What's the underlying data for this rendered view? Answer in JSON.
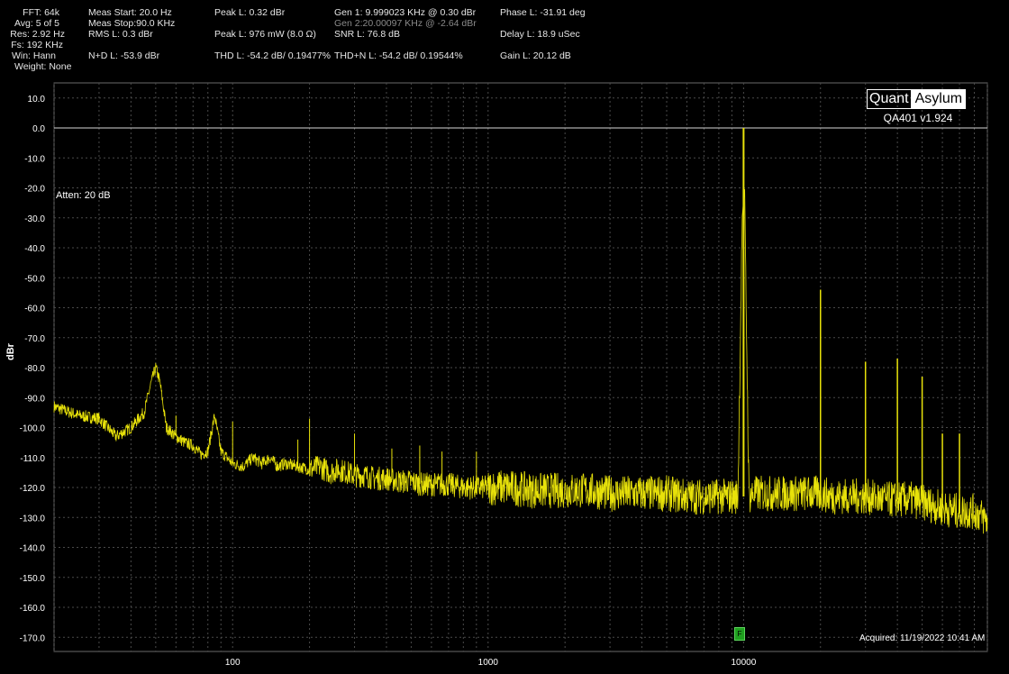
{
  "header": {
    "fft": "FFT: 64k",
    "avg": "Avg: 5 of 5",
    "res": "Res: 2.92 Hz",
    "fs": "Fs: 192 KHz",
    "win": "Win: Hann",
    "weight": "Weight: None",
    "meas_start": "Meas Start: 20.0 Hz",
    "meas_stop": "Meas Stop:90.0 KHz",
    "rms": "RMS L: 0.3 dBr",
    "nd": "N+D L: -53.9 dBr",
    "peak_l": "Peak L: 0.32 dBr",
    "peak_l_mw": "Peak L: 976 mW (8.0 Ω)",
    "thd": "THD L: -54.2 dB/ 0.19477%",
    "gen1": "Gen 1: 9.999023 KHz @ 0.30  dBr",
    "gen2": "Gen 2:20.00097 KHz @ -2.64  dBr",
    "snr": "SNR L: 76.8 dB",
    "thdn": "THD+N L: -54.2 dB/ 0.19544%",
    "phase": "Phase L: -31.91 deg",
    "delay": "Delay L: 18.9 uSec",
    "gain": "Gain L: 20.12 dB"
  },
  "logo": {
    "quant": "Quant",
    "asylum": "Asylum"
  },
  "version": "QA401 v1.924",
  "atten": "Atten: 20 dB",
  "acquired": "Acquired: 11/19/2022  10:41 AM",
  "marker_label": "F",
  "colors": {
    "trace": "#e8e20a",
    "grid": "#4a4a4a",
    "ref_line": "#d8d8d8",
    "background": "#000000"
  },
  "chart_data": {
    "type": "line",
    "title": "",
    "xlabel": "",
    "ylabel": "dBr",
    "x_scale": "log",
    "xlim": [
      20,
      90000
    ],
    "ylim": [
      -175,
      15
    ],
    "xticks": [
      100,
      1000,
      10000
    ],
    "xtick_labels": [
      "100",
      "1000",
      "10000"
    ],
    "yticks": [
      10,
      0,
      -10,
      -20,
      -30,
      -40,
      -50,
      -60,
      -70,
      -80,
      -90,
      -100,
      -110,
      -120,
      -130,
      -140,
      -150,
      -160,
      -170
    ],
    "ytick_labels": [
      "10.0",
      "0.0",
      "-10.0",
      "-20.0",
      "-30.0",
      "-40.0",
      "-50.0",
      "-60.0",
      "-70.0",
      "-80.0",
      "-90.0",
      "-100.0",
      "-110.0",
      "-120.0",
      "-130.0",
      "-140.0",
      "-150.0",
      "-160.0",
      "-170.0"
    ],
    "grid": true,
    "reference_line_y": 0,
    "series": [
      {
        "color": "#e8e20a",
        "x": [
          20,
          25,
          30,
          35,
          40,
          45,
          48,
          50,
          52,
          55,
          60,
          65,
          70,
          75,
          80,
          85,
          90,
          95,
          100,
          110,
          120,
          130,
          140,
          150,
          160,
          180,
          200,
          220,
          240,
          260,
          280,
          300,
          330,
          360,
          400,
          450,
          500,
          550,
          600,
          700,
          800,
          900,
          1000,
          1200,
          1500,
          2000,
          2500,
          3000,
          4000,
          5000,
          6000,
          7000,
          8000,
          9000,
          9500,
          9999,
          10500,
          11000,
          12000,
          14000,
          16000,
          18000,
          20000,
          22000,
          25000,
          30000,
          35000,
          40000,
          45000,
          50000,
          55000,
          60000,
          70000,
          80000,
          90000
        ],
        "y": [
          -93,
          -96,
          -97,
          -103,
          -100,
          -95,
          -85,
          -80,
          -85,
          -100,
          -103,
          -105,
          -106,
          -109,
          -108,
          -96,
          -108,
          -110,
          -112,
          -113,
          -110,
          -112,
          -110,
          -113,
          -112,
          -113,
          -114,
          -113,
          -115,
          -114,
          -115,
          -116,
          -116,
          -117,
          -117,
          -118,
          -118,
          -119,
          -119,
          -119,
          -120,
          -120,
          -120,
          -120,
          -121,
          -121,
          -121,
          -122,
          -122,
          -122,
          -123,
          -123,
          -123,
          -123,
          -123,
          0,
          -123,
          -122,
          -122,
          -122,
          -122,
          -122,
          -122,
          -123,
          -123,
          -123,
          -124,
          -124,
          -124,
          -125,
          -126,
          -127,
          -128,
          -128,
          -131
        ]
      }
    ],
    "harmonic_peaks": {
      "x": [
        20000,
        30000,
        40000,
        50000,
        60000,
        70000
      ],
      "y": [
        -54,
        -78,
        -77,
        -83,
        -102,
        -102
      ]
    },
    "spurs": {
      "x": [
        60,
        100,
        120,
        180,
        200,
        300,
        420,
        540,
        660,
        900
      ],
      "y": [
        -96,
        -98,
        -110,
        -104,
        -97,
        -102,
        -107,
        -106,
        -108,
        -108
      ]
    }
  }
}
